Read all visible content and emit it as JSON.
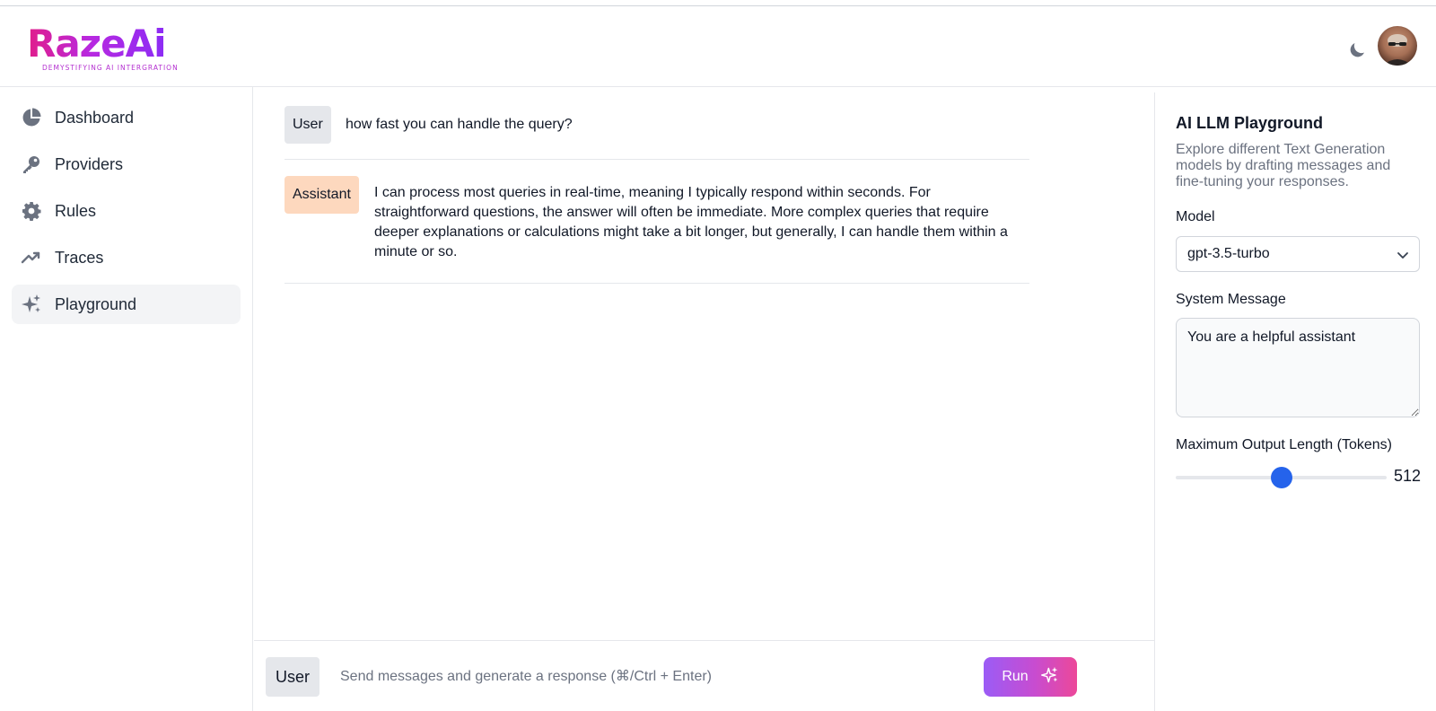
{
  "brand": {
    "logo_text": "RazeAi",
    "tagline": "DEMYSTIFYING AI INTERGRATION"
  },
  "header": {
    "theme_icon": "moon-icon",
    "avatar_icon": "user-avatar"
  },
  "sidebar": {
    "items": [
      {
        "label": "Dashboard",
        "icon": "pie-chart-icon",
        "active": false
      },
      {
        "label": "Providers",
        "icon": "key-icon",
        "active": false
      },
      {
        "label": "Rules",
        "icon": "gear-icon",
        "active": false
      },
      {
        "label": "Traces",
        "icon": "trending-up-icon",
        "active": false
      },
      {
        "label": "Playground",
        "icon": "sparkles-icon",
        "active": true
      }
    ]
  },
  "conversation": {
    "messages": [
      {
        "role": "User",
        "text": "how fast you can handle the query?"
      },
      {
        "role": "Assistant",
        "text": "I can process most queries in real-time, meaning I typically respond within seconds. For straightforward questions, the answer will often be immediate. More complex queries that require deeper explanations or calculations might take a bit longer, but generally, I can handle them within a minute or so."
      }
    ]
  },
  "composer": {
    "role": "User",
    "placeholder": "Send messages and generate a response (⌘/Ctrl + Enter)",
    "run_label": "Run",
    "run_icon": "sparkles-icon"
  },
  "panel": {
    "title": "AI LLM Playground",
    "description": "Explore different Text Generation models by drafting messages and fine-tuning your responses.",
    "model_label": "Model",
    "model_value": "gpt-3.5-turbo",
    "system_label": "System Message",
    "system_value": "You are a helpful assistant",
    "max_tokens_label": "Maximum Output Length (Tokens)",
    "max_tokens_value": "512",
    "max_tokens_fraction": 0.5
  },
  "colors": {
    "accent": "#2563eb",
    "assistant_badge": "#fdd8be",
    "run_gradient_start": "#9b5cf6",
    "run_gradient_end": "#ec4899"
  }
}
